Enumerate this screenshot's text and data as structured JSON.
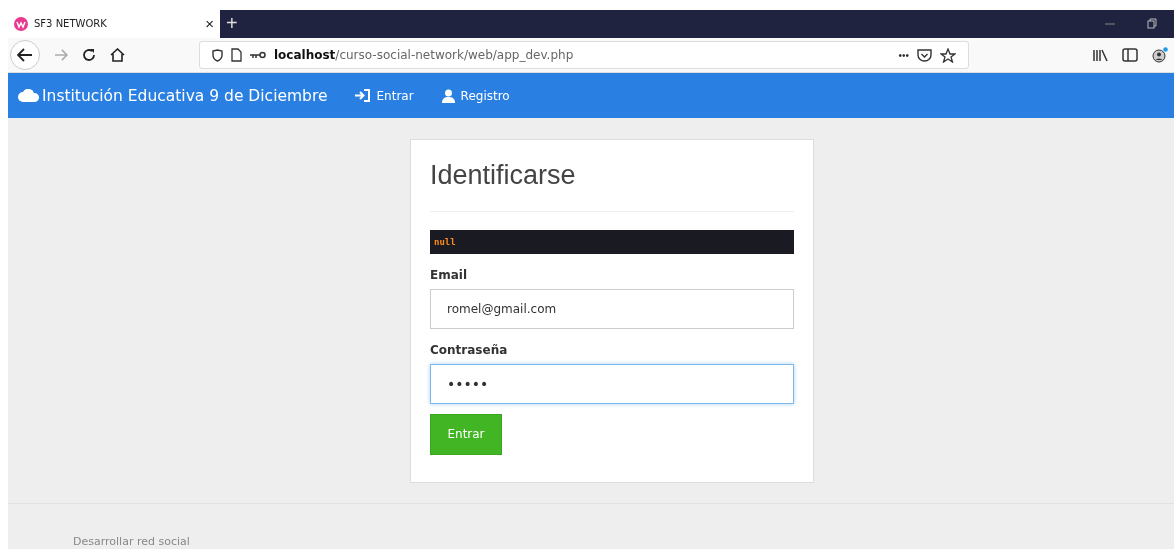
{
  "browser": {
    "tab": {
      "title": "SF3 NETWORK",
      "close": "×"
    },
    "new_tab": "+",
    "url": {
      "host": "localhost",
      "path": "/curso-social-network/web/app_dev.php"
    },
    "page_actions": "•••"
  },
  "navbar": {
    "brand": "Institución Educativa 9 de Diciembre",
    "links": [
      {
        "label": "Entrar",
        "kind": "login"
      },
      {
        "label": "Registro",
        "kind": "user"
      }
    ]
  },
  "login": {
    "title": "Identificarse",
    "debug": "null",
    "fields": [
      {
        "label": "Email",
        "value": "romel@gmail.com",
        "focused": false
      },
      {
        "label": "Contraseña",
        "value": "•••••",
        "focused": true
      }
    ],
    "submit": "Entrar"
  },
  "footer": {
    "text": "Desarrollar red social"
  }
}
